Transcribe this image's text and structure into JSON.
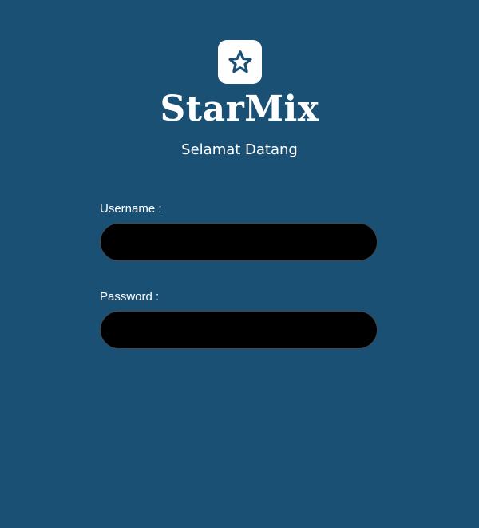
{
  "app": {
    "title": "StarMix",
    "subtitle": "Selamat Datang",
    "logo_icon": "star-icon",
    "background_color": "#1b5075",
    "logo_background_color": "#ffffff",
    "logo_icon_color": "#1b5075"
  },
  "login_form": {
    "username": {
      "label": "Username :",
      "value": "",
      "placeholder": ""
    },
    "password": {
      "label": "Password :",
      "value": "",
      "placeholder": ""
    },
    "input_background_color": "#000000"
  }
}
